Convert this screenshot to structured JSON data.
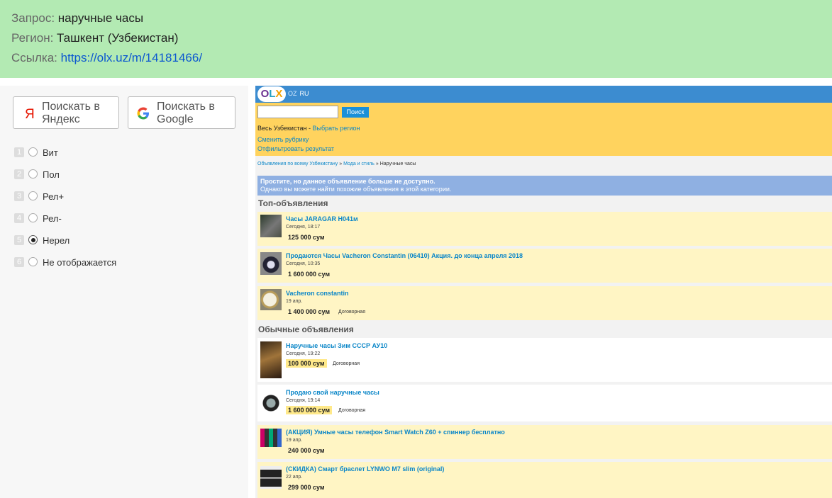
{
  "header": {
    "query_label": "Запрос:",
    "query_value": "наручные часы",
    "region_label": "Регион:",
    "region_value": "Ташкент (Узбекистан)",
    "link_label": "Ссылка:",
    "link_value": "https://olx.uz/m/14181466/"
  },
  "search_buttons": {
    "yandex": "Поискать в Яндекс",
    "google": "Поискать в Google"
  },
  "options": [
    {
      "num": "1",
      "label": "Вит",
      "selected": false
    },
    {
      "num": "2",
      "label": "Пол",
      "selected": false
    },
    {
      "num": "3",
      "label": "Рел+",
      "selected": false
    },
    {
      "num": "4",
      "label": "Рел-",
      "selected": false
    },
    {
      "num": "5",
      "label": "Нерел",
      "selected": true
    },
    {
      "num": "6",
      "label": "Не отображается",
      "selected": false
    }
  ],
  "olx": {
    "logo": "OLX",
    "lang_oz": "OZ",
    "lang_ru": "RU",
    "search_placeholder": "",
    "search_button": "Поиск",
    "region_text": "Весь Узбекистан - ",
    "choose_region": "Выбрать регион",
    "change_category": "Сменить рубрику",
    "filter_results": "Отфильтровать результат",
    "crumb_all": "Объявления по всему Узбекистану",
    "crumb_sep": " » ",
    "crumb_fashion": "Мода и стиль",
    "crumb_current": "Наручные часы",
    "notice_title": "Простите, но данное объявление больше не доступно.",
    "notice_text": "Однако вы можете найти похожие объявления в этой категории.",
    "top_title": "Топ-объявления",
    "regular_title": "Обычные объявления",
    "top_ads": [
      {
        "title": "Часы JARAGAR H041м",
        "date": "Сегодня, 18:17",
        "price": "125 000 сум",
        "negotiable": ""
      },
      {
        "title": "Продаются Часы Vacheron Constantin (06410) Акция. до конца апреля 2018",
        "date": "Сегодня, 10:35",
        "price": "1 600 000 сум",
        "negotiable": ""
      },
      {
        "title": "Vacheron constantin",
        "date": "19 апр.",
        "price": "1 400 000 сум",
        "negotiable": "Договорная"
      }
    ],
    "regular_ads": [
      {
        "title": "Наручные часы Зим СССР АУ10",
        "date": "Сегодня, 19:22",
        "price": "100 000 сум",
        "negotiable": "Договорная"
      },
      {
        "title": "Продаю свой наручные часы",
        "date": "Сегодня, 19:14",
        "price": "1 600 000 сум",
        "negotiable": "Договорная"
      },
      {
        "title": "(АКЦИЯ) Умные часы телефон Smart Watch Z60 + спиннер бесплатно",
        "date": "19 апр.",
        "price": "240 000 сум",
        "negotiable": ""
      },
      {
        "title": "(СКИДКА) Смарт браслет LYNWO M7 slim (original)",
        "date": "22 апр.",
        "price": "299 000 сум",
        "negotiable": ""
      }
    ]
  }
}
